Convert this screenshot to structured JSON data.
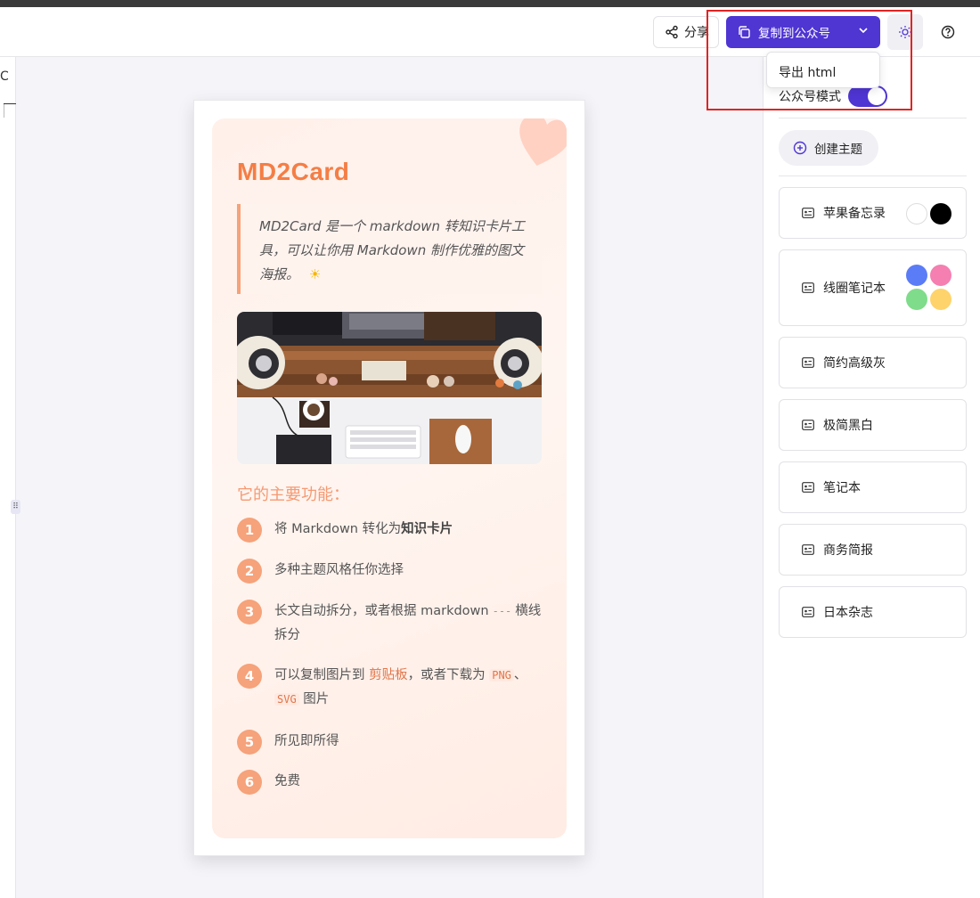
{
  "header": {
    "share_label": "分享",
    "copy_label": "复制到公众号"
  },
  "dropdown": {
    "export_label": "导出 html"
  },
  "left_strip": {
    "glyph": "C"
  },
  "card": {
    "title": "MD2Card",
    "quote": "MD2Card 是一个 markdown 转知识卡片工具，可以让你用 Markdown 制作优雅的图文海报。",
    "quote_emoji": "☀",
    "section_title": "它的主要功能：",
    "features": [
      {
        "num": "1",
        "text_before": "将 Markdown 转化为",
        "bold": "知识卡片"
      },
      {
        "num": "2",
        "text": "多种主题风格任你选择"
      },
      {
        "num": "3",
        "text_before": "长文自动拆分，或者根据 markdown",
        "code": "---",
        "text_after": "横线拆分"
      },
      {
        "num": "4",
        "text_before": "可以复制图片到",
        "link": "剪贴板",
        "text_mid": "，或者下载为",
        "code1": "PNG",
        "sep": "、",
        "code2": "SVG",
        "text_after": "图片"
      },
      {
        "num": "5",
        "text": "所见即所得"
      },
      {
        "num": "6",
        "text": "免费"
      }
    ]
  },
  "sidebar": {
    "mode_label": "公众号模式",
    "mode_on": true,
    "create_label": "创建主题",
    "themes": [
      {
        "name": "苹果备忘录",
        "swatches": [
          "#ffffff",
          "#000000"
        ]
      },
      {
        "name": "线圈笔记本",
        "swatches": [
          "#5b7cf7",
          "#f47fb0",
          "#7fdc8a",
          "#ffd36b"
        ]
      },
      {
        "name": "简约高级灰"
      },
      {
        "name": "极简黑白"
      },
      {
        "name": "笔记本"
      },
      {
        "name": "商务简报"
      },
      {
        "name": "日本杂志"
      }
    ]
  },
  "colors": {
    "accent": "#4f35d2",
    "card_title": "#f47e45",
    "badge": "#f6a27a",
    "highlight": "#e02424"
  }
}
